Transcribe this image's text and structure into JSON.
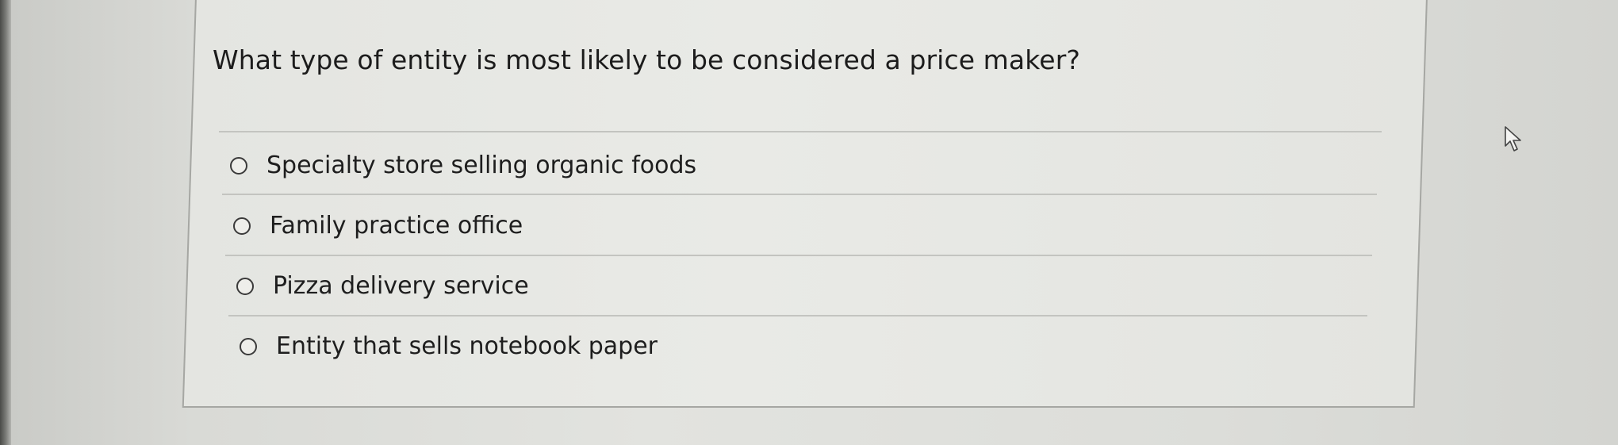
{
  "question": {
    "text": "What type of entity is most likely to be considered a price maker?"
  },
  "options": [
    {
      "label": "Specialty store selling organic foods",
      "selected": false
    },
    {
      "label": "Family practice office",
      "selected": false
    },
    {
      "label": "Pizza delivery service",
      "selected": false
    },
    {
      "label": "Entity that sells notebook paper",
      "selected": false
    }
  ],
  "icons": {
    "radio": "radio-unselected-icon",
    "cursor": "mouse-pointer-icon"
  }
}
